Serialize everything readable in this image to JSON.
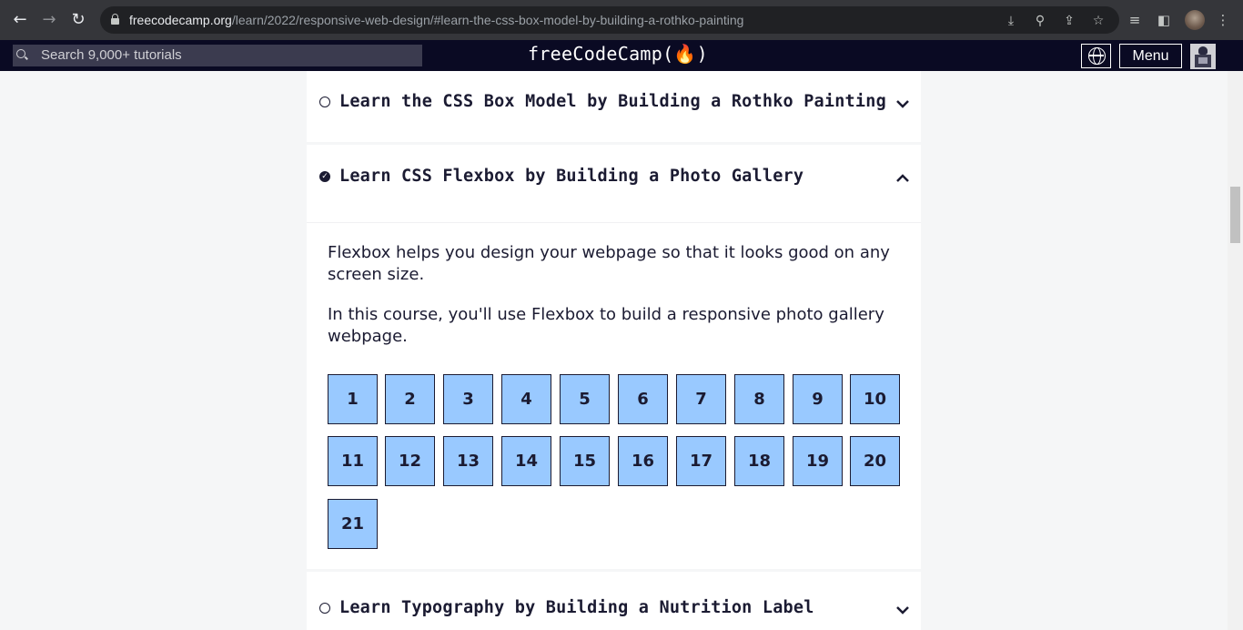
{
  "browser": {
    "url_host": "freecodecamp.org",
    "url_path": "/learn/2022/responsive-web-design/#learn-the-css-box-model-by-building-a-rothko-painting"
  },
  "fcc_nav": {
    "search_placeholder": "Search 9,000+ tutorials",
    "logo": "freeCodeCamp(🔥)",
    "menu_label": "Menu"
  },
  "blocks": [
    {
      "title": "Learn the CSS Box Model by Building a Rothko Painting",
      "completed": false,
      "expanded": false
    },
    {
      "title": "Learn CSS Flexbox by Building a Photo Gallery",
      "completed": true,
      "expanded": true,
      "description_1": "Flexbox helps you design your webpage so that it looks good on any screen size.",
      "description_2": "In this course, you'll use Flexbox to build a responsive photo gallery webpage.",
      "steps": [
        "1",
        "2",
        "3",
        "4",
        "5",
        "6",
        "7",
        "8",
        "9",
        "10",
        "11",
        "12",
        "13",
        "14",
        "15",
        "16",
        "17",
        "18",
        "19",
        "20",
        "21"
      ]
    },
    {
      "title": "Learn Typography by Building a Nutrition Label",
      "completed": false,
      "expanded": false
    }
  ],
  "colors": {
    "nav_bg": "#0a0a23",
    "step_bg": "#99c9ff",
    "text": "#1b1b32"
  }
}
